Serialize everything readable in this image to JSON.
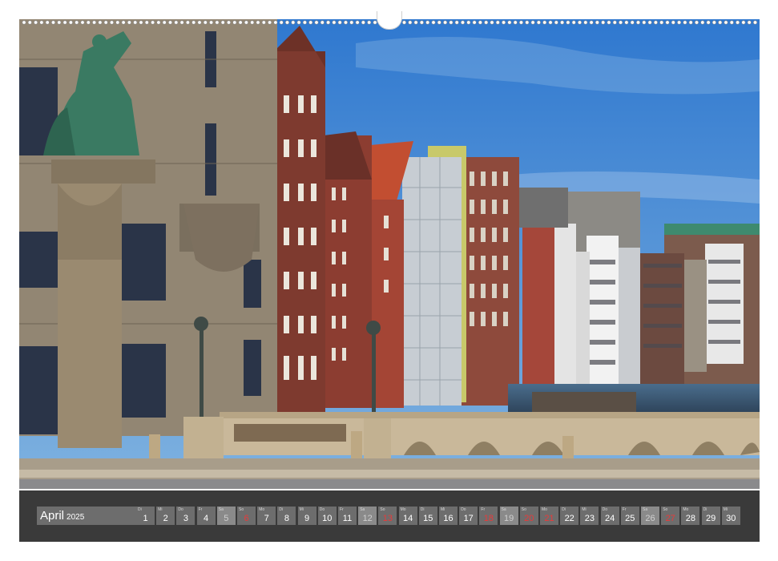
{
  "calendar": {
    "month": "April",
    "year": "2025",
    "days": [
      {
        "wd": "Di",
        "d": "1"
      },
      {
        "wd": "Mi",
        "d": "2"
      },
      {
        "wd": "Do",
        "d": "3"
      },
      {
        "wd": "Fr",
        "d": "4"
      },
      {
        "wd": "Sa",
        "d": "5",
        "we": true
      },
      {
        "wd": "So",
        "d": "6",
        "red": true
      },
      {
        "wd": "Mo",
        "d": "7"
      },
      {
        "wd": "Di",
        "d": "8"
      },
      {
        "wd": "Mi",
        "d": "9"
      },
      {
        "wd": "Do",
        "d": "10"
      },
      {
        "wd": "Fr",
        "d": "11"
      },
      {
        "wd": "Sa",
        "d": "12",
        "we": true
      },
      {
        "wd": "So",
        "d": "13",
        "red": true
      },
      {
        "wd": "Mo",
        "d": "14"
      },
      {
        "wd": "Di",
        "d": "15"
      },
      {
        "wd": "Mi",
        "d": "16"
      },
      {
        "wd": "Do",
        "d": "17"
      },
      {
        "wd": "Fr",
        "d": "18",
        "red": true
      },
      {
        "wd": "Sa",
        "d": "19",
        "we": true
      },
      {
        "wd": "So",
        "d": "20",
        "red": true
      },
      {
        "wd": "Mo",
        "d": "21",
        "red": true
      },
      {
        "wd": "Di",
        "d": "22"
      },
      {
        "wd": "Mi",
        "d": "23"
      },
      {
        "wd": "Do",
        "d": "24"
      },
      {
        "wd": "Fr",
        "d": "25"
      },
      {
        "wd": "Sa",
        "d": "26",
        "we": true
      },
      {
        "wd": "So",
        "d": "27",
        "red": true
      },
      {
        "wd": "Mo",
        "d": "28"
      },
      {
        "wd": "Di",
        "d": "29"
      },
      {
        "wd": "Mi",
        "d": "30"
      }
    ]
  },
  "colors": {
    "sky": "#3f86d3",
    "water": "#2f4a63",
    "strip": "#3a3a3a",
    "holiday_red": "#e83a3a"
  }
}
